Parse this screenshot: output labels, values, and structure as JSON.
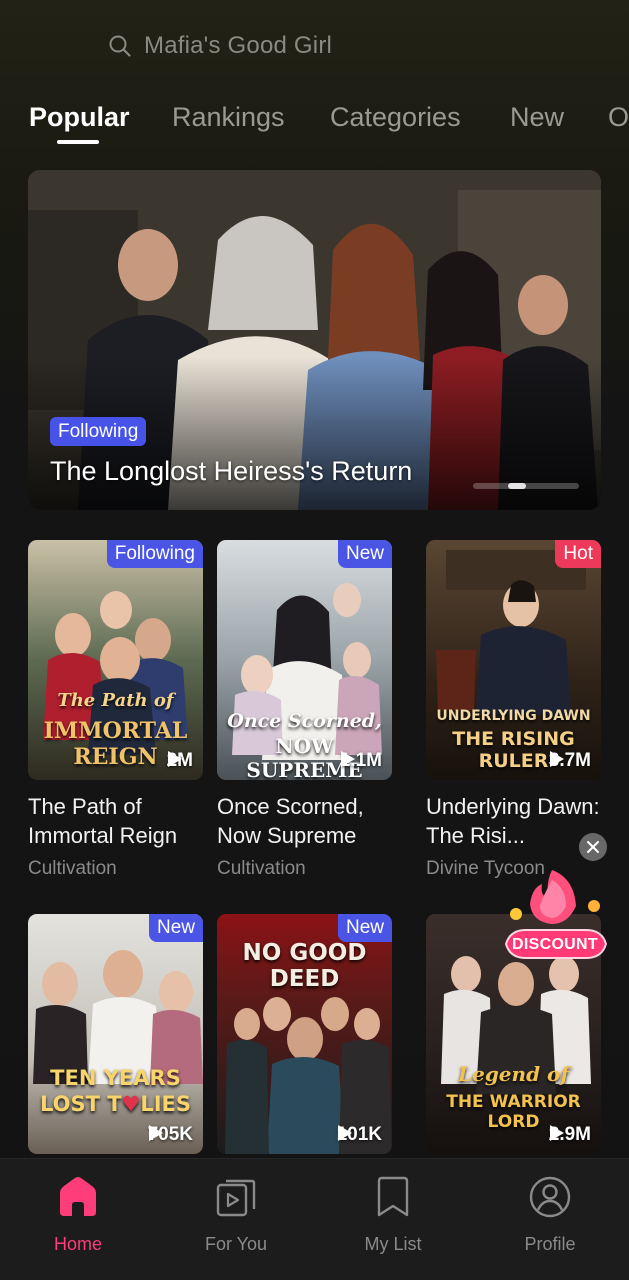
{
  "search": {
    "placeholder": "Mafia's Good Girl"
  },
  "tabs": [
    {
      "label": "Popular",
      "active": true
    },
    {
      "label": "Rankings"
    },
    {
      "label": "Categories"
    },
    {
      "label": "New"
    },
    {
      "label": "O"
    }
  ],
  "banner": {
    "badge": "Following",
    "title": "The Longlost Heiress's Return",
    "carousel_position": "2 of 3"
  },
  "cards": [
    {
      "badge": "Following",
      "badge_color": "#4a55e6",
      "views": "2M",
      "title": "The Path of Immortal Reign",
      "genre": "Cultivation",
      "poster_text": [
        "The Path of",
        "IMMORTAL REIGN"
      ]
    },
    {
      "badge": "New",
      "badge_color": "#4a55e6",
      "views": "1.1M",
      "title": "Once Scorned, Now Supreme",
      "genre": "Cultivation",
      "poster_text": [
        "Once Scorned,",
        "NOW SUPREME"
      ]
    },
    {
      "badge": "Hot",
      "badge_color": "#ee3a5a",
      "views": "3.7M",
      "title": "Underlying Dawn: The Risi...",
      "genre": "Divine Tycoon",
      "poster_text": [
        "UNDERLYING DAWN",
        "THE RISING RULER"
      ]
    },
    {
      "badge": "New",
      "badge_color": "#4a55e6",
      "views": "705K",
      "poster_text": [
        "TEN YEARS",
        "LOST T",
        "LIES"
      ]
    },
    {
      "badge": "New",
      "badge_color": "#4a55e6",
      "views": "101K",
      "poster_text": [
        "NO GOOD DEED"
      ]
    },
    {
      "views": "2.9M",
      "poster_text": [
        "Legend of",
        "THE WARRIOR LORD"
      ]
    }
  ],
  "discount": {
    "label": "DISCOUNT"
  },
  "bottom_nav": [
    {
      "label": "Home",
      "icon": "home-icon",
      "active": true
    },
    {
      "label": "For You",
      "icon": "play-stack-icon"
    },
    {
      "label": "My List",
      "icon": "bookmark-icon"
    },
    {
      "label": "Profile",
      "icon": "profile-icon"
    }
  ],
  "colors": {
    "accent": "#ff3d7a",
    "badge_blue": "#4a55e6",
    "badge_red": "#ee3a5a",
    "background": "#131313"
  }
}
